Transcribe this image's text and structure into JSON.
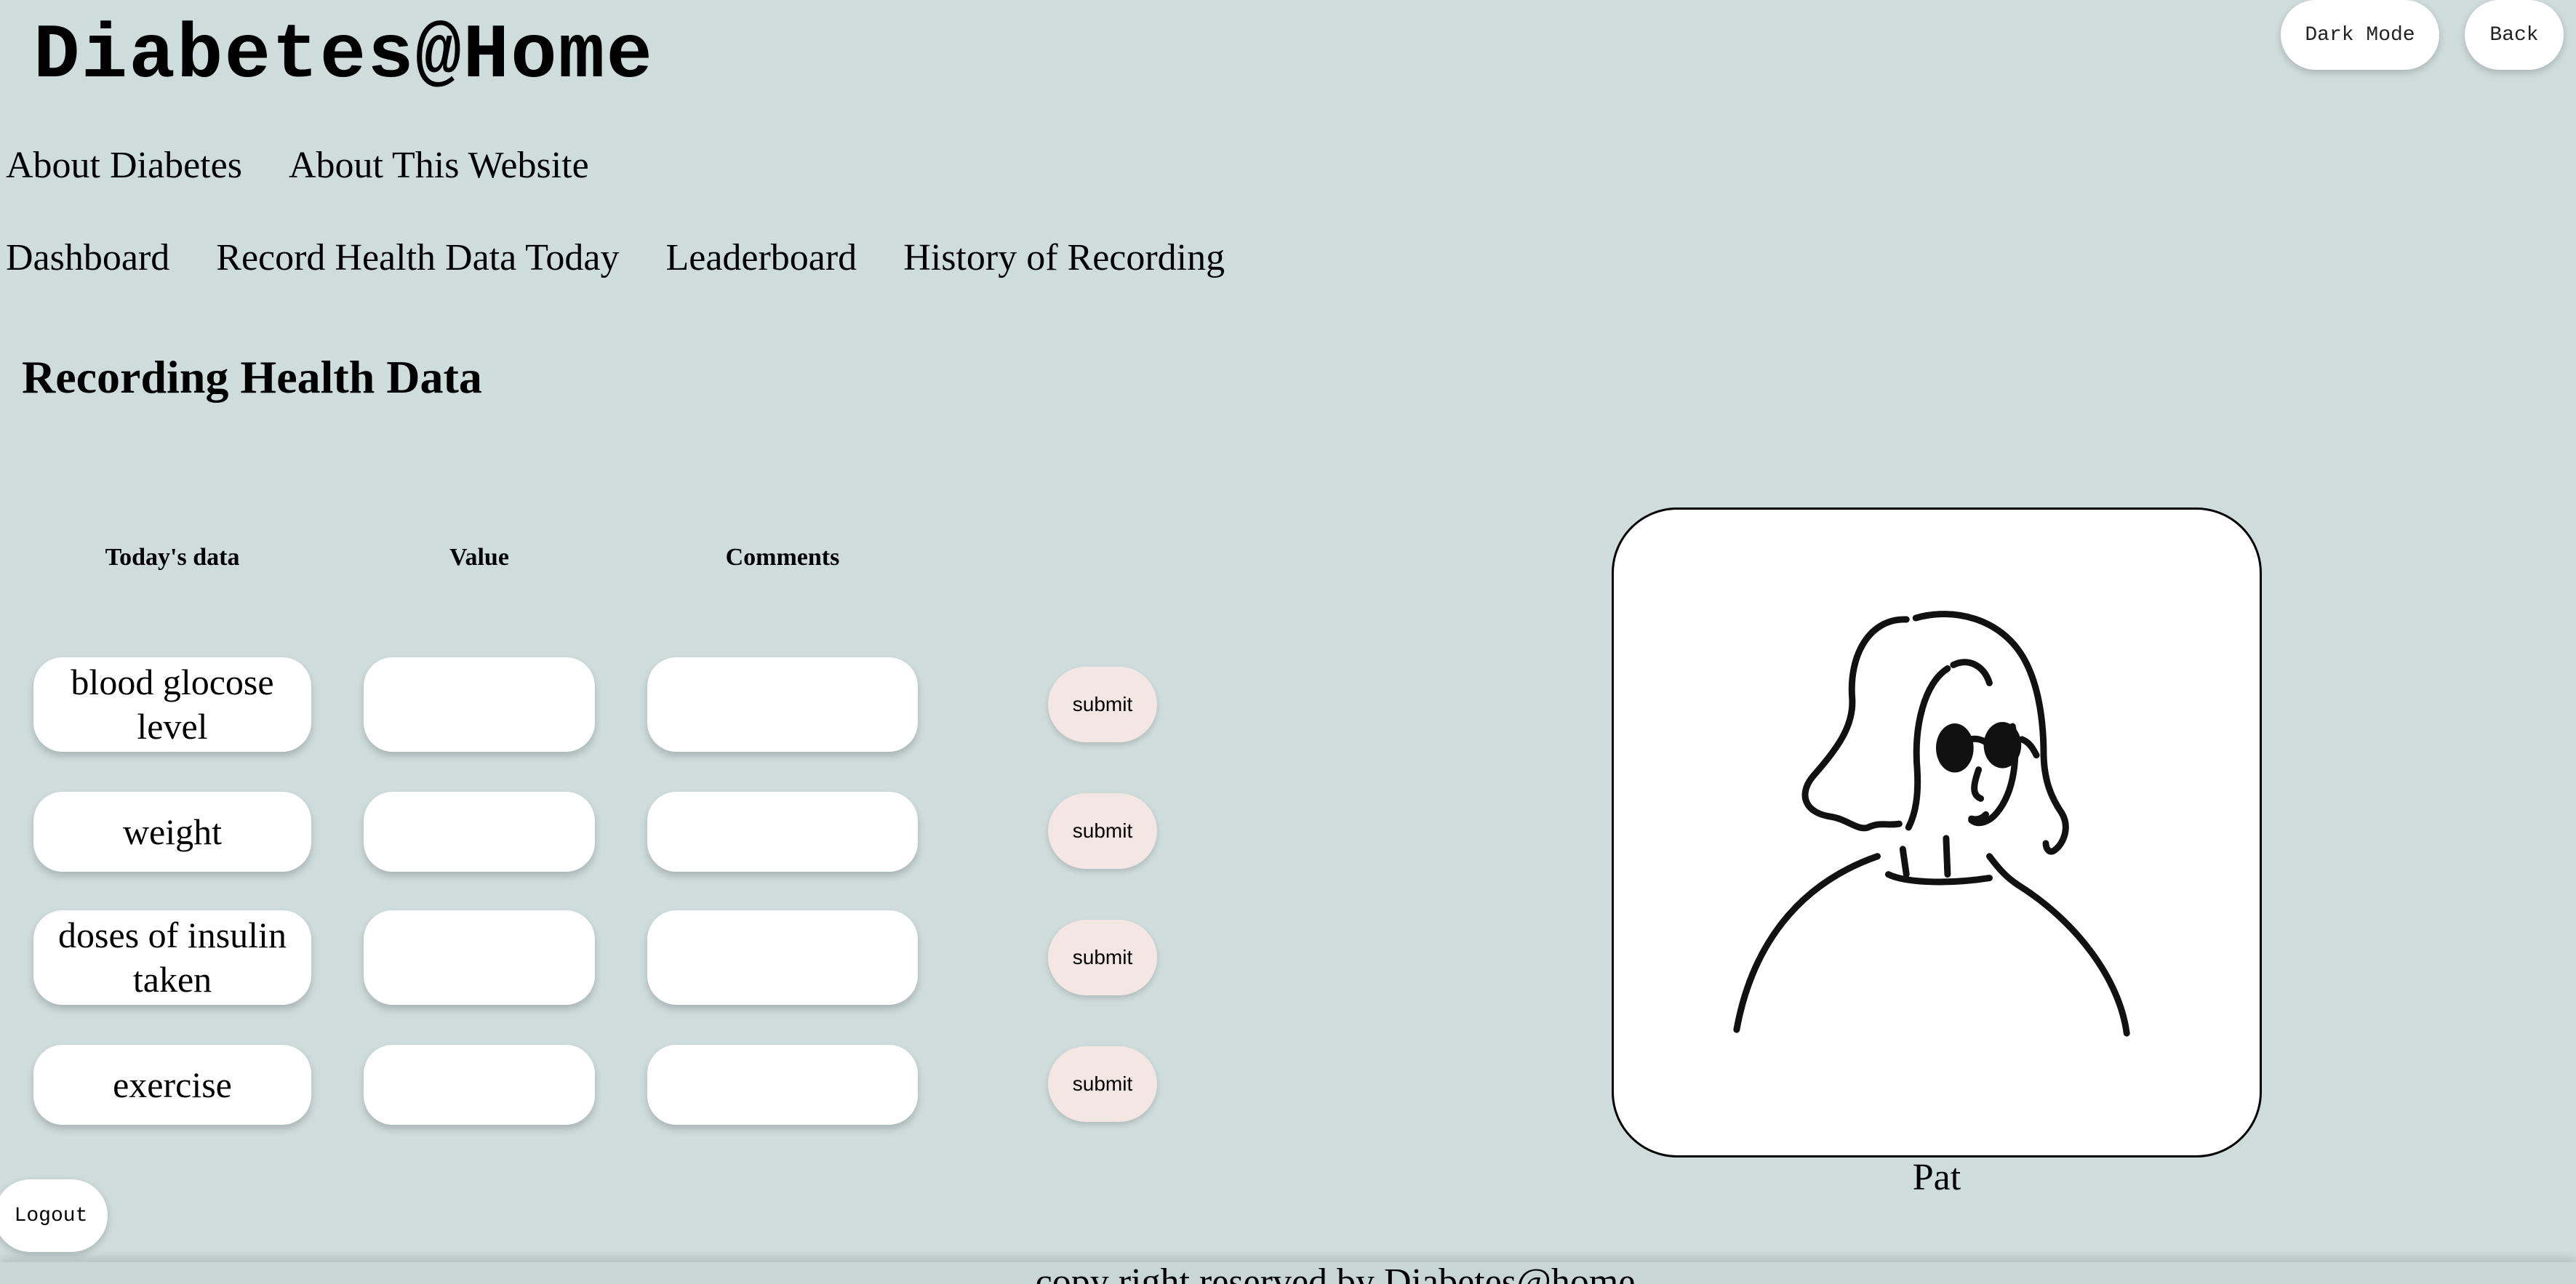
{
  "header": {
    "site_title": "Diabetes@Home",
    "dark_mode_label": "Dark Mode",
    "back_label": "Back"
  },
  "nav_primary": [
    "About Diabetes",
    "About This Website"
  ],
  "nav_secondary": [
    "Dashboard",
    "Record Health Data Today",
    "Leaderboard",
    "History of Recording"
  ],
  "page_heading": "Recording Health Data",
  "table": {
    "headers": [
      "Today's data",
      "Value",
      "Comments"
    ],
    "rows": [
      {
        "label": "blood glocose level",
        "value": "",
        "comment": "",
        "submit": "submit"
      },
      {
        "label": "weight",
        "value": "",
        "comment": "",
        "submit": "submit"
      },
      {
        "label": "doses of insulin taken",
        "value": "",
        "comment": "",
        "submit": "submit"
      },
      {
        "label": "exercise",
        "value": "",
        "comment": "",
        "submit": "submit"
      }
    ]
  },
  "profile": {
    "name": "Pat",
    "avatar_icon": "woman-with-sunglasses-illustration"
  },
  "logout_label": "Logout",
  "footer_text": "copy right reserved by Diabetes@home",
  "colors": {
    "background": "#cfdcdc",
    "submit_button": "#f3e6e3",
    "card": "#ffffff"
  }
}
